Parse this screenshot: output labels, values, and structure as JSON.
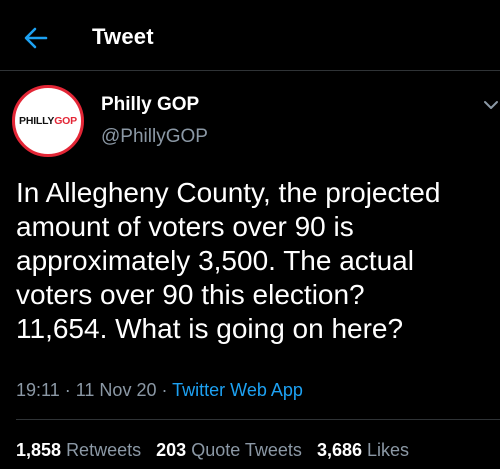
{
  "header": {
    "title": "Tweet",
    "back_icon": "arrow-left-icon"
  },
  "colors": {
    "accent": "#1da1f2",
    "muted": "#8b98a5",
    "logo_red": "#e32636"
  },
  "author": {
    "name": "Philly GOP",
    "handle": "@PhillyGOP",
    "avatar_text_a": "PHILLY",
    "avatar_text_b": "GOP"
  },
  "tweet": {
    "text": "In Allegheny County, the projected\namount of voters over 90 is\napproximately 3,500. The actual\nvoters over 90 this election?\n11,654. What is going on here?",
    "time": "19:11",
    "date": "11 Nov 20",
    "separator": "·",
    "source": "Twitter Web App"
  },
  "stats": {
    "retweets_count": "1,858",
    "retweets_label": "Retweets",
    "quotes_count": "203",
    "quotes_label": "Quote Tweets",
    "likes_count": "3,686",
    "likes_label": "Likes"
  }
}
